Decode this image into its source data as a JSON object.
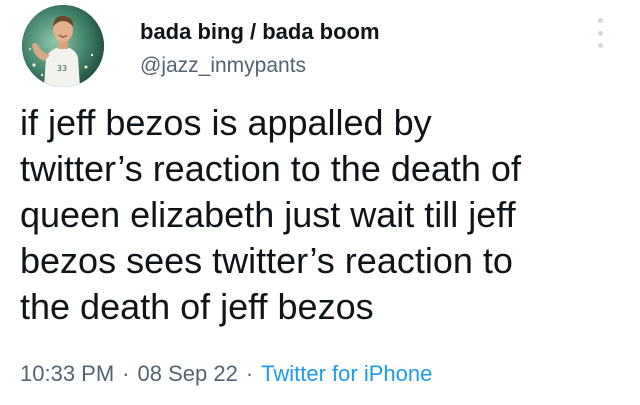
{
  "tweet": {
    "display_name": "bada bing / bada boom",
    "handle": "@jazz_inmypants",
    "text": "if jeff bezos is appalled by\ntwitter’s reaction to the death of\nqueen elizabeth just wait till jeff\nbezos sees twitter’s reaction to\nthe death of jeff bezos",
    "time": "10:33 PM",
    "date": "08 Sep 22",
    "separator": "·",
    "source": "Twitter for iPhone"
  },
  "icons": {
    "more": "more-options-icon",
    "avatar": "user-avatar"
  },
  "colors": {
    "text": "#0f1419",
    "secondary": "#536471",
    "link": "#1d9bf0"
  }
}
